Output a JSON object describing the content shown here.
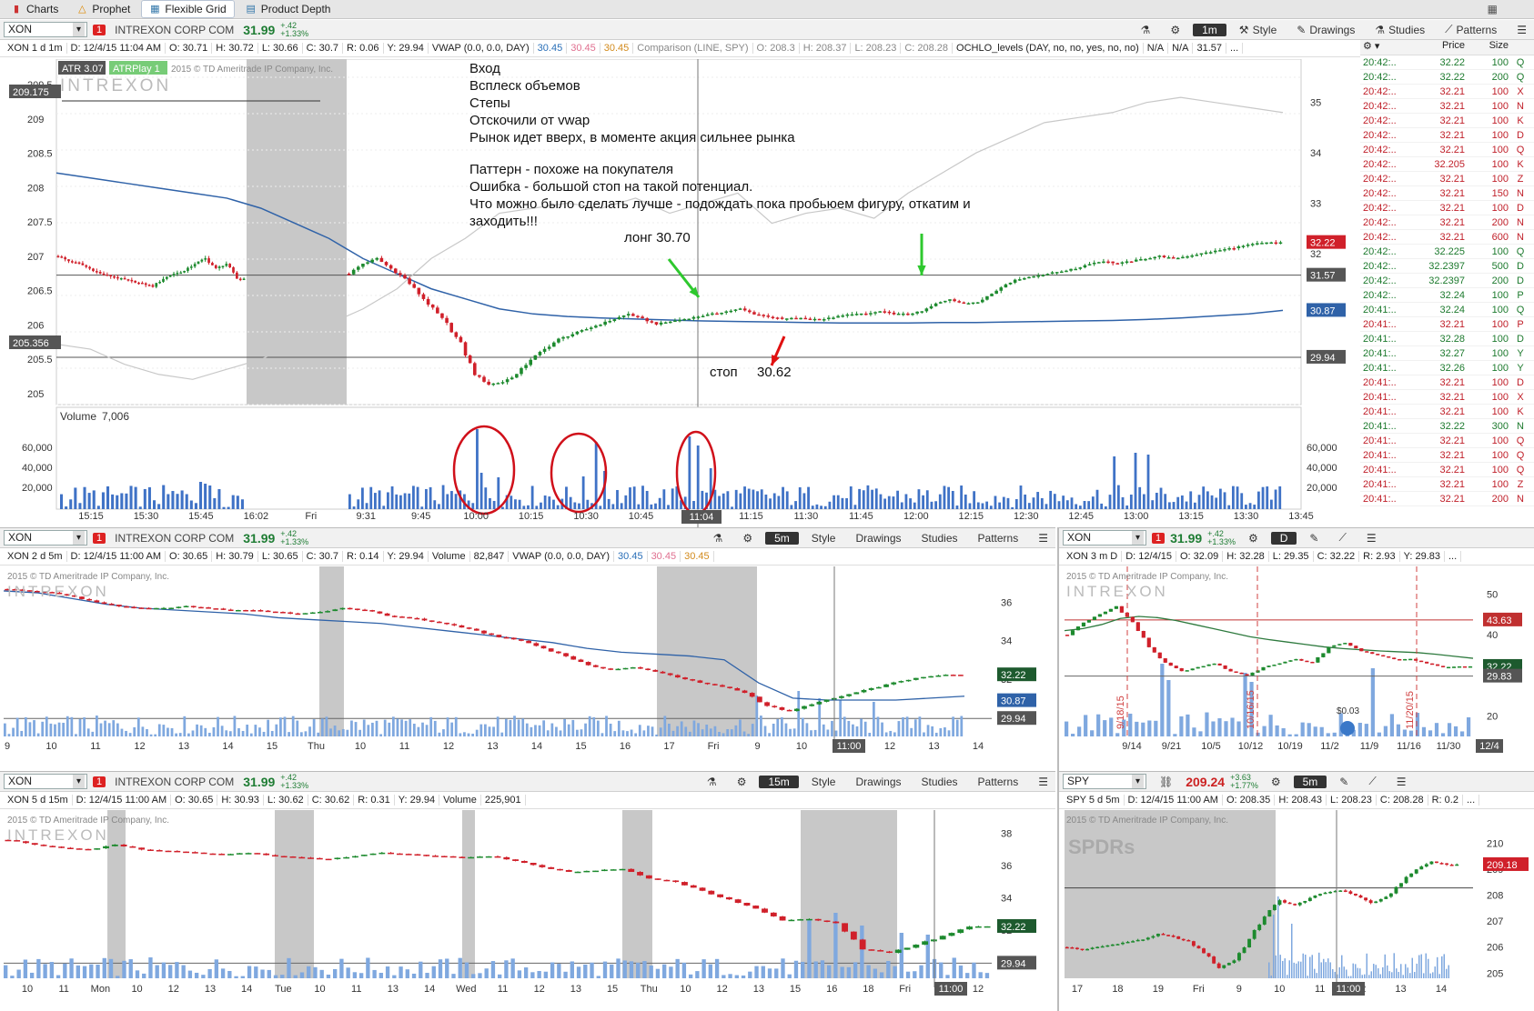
{
  "tabs": [
    {
      "label": "Charts",
      "icon": "bars-icon"
    },
    {
      "label": "Prophet",
      "icon": "triangle-icon"
    },
    {
      "label": "Flexible Grid",
      "icon": "grid-icon"
    },
    {
      "label": "Product Depth",
      "icon": "depth-icon"
    }
  ],
  "common": {
    "symbol": "XON",
    "company": "INTREXON CORP COM",
    "price": "31.99",
    "change": "+.42",
    "change_pct": "+1.33%",
    "style": "Style",
    "drawings": "Drawings",
    "studies": "Studies",
    "patterns": "Patterns",
    "copyright": "2015 © TD Ameritrade IP Company, Inc.",
    "watermark": "INTREXON"
  },
  "main": {
    "aggregation": "1m",
    "info": [
      "XON 1 d 1m",
      "D: 12/4/15 11:04 AM",
      "O: 30.71",
      "H: 30.72",
      "L: 30.66",
      "C: 30.7",
      "R: 0.06",
      "Y: 29.94",
      "VWAP (0.0, 0.0, DAY)",
      "30.45",
      "30.45",
      "30.45",
      "Comparison (LINE, SPY)",
      "O: 208.3",
      "H: 208.37",
      "L: 208.23",
      "C: 208.28",
      "OCHLO_levels (DAY, no, no, yes, no, no)",
      "N/A",
      "N/A",
      "31.57",
      "..."
    ],
    "atr": "ATR 3.07",
    "atrplay": "ATRPlay 1",
    "left_labels": {
      "top": "209.175",
      "bottom": "205.356"
    },
    "right_labels": {
      "last": "32.22",
      "level": "31.57",
      "vwap": "30.87",
      "prevclose": "29.94"
    },
    "annotations": {
      "lines1": [
        "Вход",
        "Всплеск объемов",
        "Степы",
        "Отскочили от vwap",
        "Рынок идет вверх, в моменте акция сильнее рынка"
      ],
      "lines2": [
        "Паттерн - похоже на покупателя",
        "Ошибка - большой стоп на такой потенциал.",
        "Что можно было сделать лучше - подождать пока пробьюем фигуру, откатим и",
        "заходить!!!"
      ],
      "long": "лонг 30.70",
      "stop": "стоп",
      "stop_price": "30.62"
    },
    "volume_label": "Volume",
    "volume_value": "7,006",
    "chart_data": {
      "type": "line",
      "x_ticks": [
        "15:15",
        "15:30",
        "15:45",
        "16:02",
        "Fri",
        "9:31",
        "9:45",
        "10:00",
        "10:15",
        "10:30",
        "10:45",
        "11:04",
        "11:15",
        "11:30",
        "11:45",
        "12:00",
        "12:15",
        "12:30",
        "12:45",
        "13:00",
        "13:15",
        "13:30",
        "13:45"
      ],
      "y_right": [
        "35",
        "34",
        "33",
        "32",
        "30"
      ],
      "y_left": [
        "209.5",
        "209",
        "208.5",
        "208",
        "207.5",
        "207",
        "206.5",
        "206",
        "205.5",
        "205"
      ],
      "vol_ticks": [
        "60,000",
        "40,000",
        "20,000"
      ],
      "ylim": [
        29,
        35.5
      ],
      "series": [
        {
          "name": "",
          "values": [
            31.95,
            31.85,
            31.8,
            31.7,
            31.6,
            31.55,
            31.5,
            31.45,
            31.4,
            31.35,
            31.5,
            31.6,
            31.65,
            31.8,
            31.9,
            31.7,
            31.8,
            31.5,
            31.6,
            31.8,
            31.9,
            31.7,
            31.5,
            31.2,
            30.9,
            30.6,
            30.2,
            29.6,
            29.4,
            29.45,
            29.6,
            29.9,
            30.1,
            30.3,
            30.4,
            30.5,
            30.6,
            30.7,
            30.8,
            30.7,
            30.6,
            30.65,
            30.7,
            30.75,
            30.8,
            30.85,
            30.9,
            30.8,
            30.75,
            30.7,
            30.72,
            30.7,
            30.7,
            30.75,
            30.8,
            30.8,
            30.85,
            30.8,
            30.8,
            30.85,
            31.0,
            31.1,
            31.0,
            31.05,
            31.2,
            31.4,
            31.5,
            31.55,
            31.6,
            31.65,
            31.7,
            31.8,
            31.85,
            31.8,
            31.85,
            31.9,
            31.95,
            31.9,
            31.95,
            32.0,
            32.05,
            32.1,
            32.15,
            32.2,
            32.22
          ]
        },
        {
          "name": "VWAP",
          "values": [
            33.6,
            33.5,
            33.4,
            33.3,
            33.2,
            33.1,
            32.9,
            32.6,
            32.3,
            31.9,
            31.6,
            31.3,
            31.1,
            30.9,
            30.8,
            30.75,
            30.72,
            30.7,
            30.68,
            30.66,
            30.65,
            30.64,
            30.63,
            30.62,
            30.62,
            30.62,
            30.63,
            30.63,
            30.64,
            30.65,
            30.66,
            30.67,
            30.69,
            30.72,
            30.76,
            30.8,
            30.87
          ]
        },
        {
          "name": "SPY",
          "values": [
            30.2,
            30.1,
            29.8,
            29.6,
            29.5,
            29.7,
            29.9,
            30.2,
            30.6,
            30.9,
            31.3,
            31.9,
            32.3,
            32.8,
            32.9,
            33.0,
            32.9,
            33.1,
            32.8,
            33.0,
            33.2,
            32.6,
            32.8,
            32.9,
            32.7,
            33.2,
            33.6,
            34.0,
            34.3,
            34.6,
            34.7,
            34.8,
            35.0,
            35.1,
            35.0,
            34.9,
            34.8
          ]
        }
      ]
    }
  },
  "tsg": {
    "headers": [
      "",
      "Price",
      "Size",
      ""
    ],
    "rows": [
      [
        "20:42:..",
        "32.22",
        "100",
        "Q"
      ],
      [
        "20:42:..",
        "32.22",
        "200",
        "Q"
      ],
      [
        "20:42:..",
        "32.21",
        "100",
        "X"
      ],
      [
        "20:42:..",
        "32.21",
        "100",
        "N"
      ],
      [
        "20:42:..",
        "32.21",
        "100",
        "K"
      ],
      [
        "20:42:..",
        "32.21",
        "100",
        "D"
      ],
      [
        "20:42:..",
        "32.21",
        "100",
        "Q"
      ],
      [
        "20:42:..",
        "32.205",
        "100",
        "K"
      ],
      [
        "20:42:..",
        "32.21",
        "100",
        "Z"
      ],
      [
        "20:42:..",
        "32.21",
        "150",
        "N"
      ],
      [
        "20:42:..",
        "32.21",
        "100",
        "D"
      ],
      [
        "20:42:..",
        "32.21",
        "200",
        "N"
      ],
      [
        "20:42:..",
        "32.21",
        "600",
        "N"
      ],
      [
        "20:42:..",
        "32.225",
        "100",
        "Q"
      ],
      [
        "20:42:..",
        "32.2397",
        "500",
        "D"
      ],
      [
        "20:42:..",
        "32.2397",
        "200",
        "D"
      ],
      [
        "20:42:..",
        "32.24",
        "100",
        "P"
      ],
      [
        "20:41:..",
        "32.24",
        "100",
        "Q"
      ],
      [
        "20:41:..",
        "32.21",
        "100",
        "P"
      ],
      [
        "20:41:..",
        "32.28",
        "100",
        "D"
      ],
      [
        "20:41:..",
        "32.27",
        "100",
        "Y"
      ],
      [
        "20:41:..",
        "32.26",
        "100",
        "Y"
      ],
      [
        "20:41:..",
        "32.21",
        "100",
        "D"
      ],
      [
        "20:41:..",
        "32.21",
        "100",
        "X"
      ],
      [
        "20:41:..",
        "32.21",
        "100",
        "K"
      ],
      [
        "20:41:..",
        "32.22",
        "300",
        "N"
      ],
      [
        "20:41:..",
        "32.21",
        "100",
        "Q"
      ],
      [
        "20:41:..",
        "32.21",
        "100",
        "Q"
      ],
      [
        "20:41:..",
        "32.21",
        "100",
        "Q"
      ],
      [
        "20:41:..",
        "32.21",
        "100",
        "Z"
      ],
      [
        "20:41:..",
        "32.21",
        "200",
        "N"
      ]
    ]
  },
  "p2": {
    "aggregation": "5m",
    "info": [
      "XON 2 d 5m",
      "D: 12/4/15 11:00 AM",
      "O: 30.65",
      "H: 30.79",
      "L: 30.65",
      "C: 30.7",
      "R: 0.14",
      "Y: 29.94",
      "Volume",
      "82,847",
      "VWAP (0.0, 0.0, DAY)",
      "30.45",
      "30.45",
      "30.45"
    ],
    "labels": {
      "last": "32.22",
      "vwap": "30.87",
      "prev": "29.94",
      "cursor": "11:00"
    },
    "chart_data": {
      "type": "line",
      "x_ticks": [
        "9",
        "10",
        "11",
        "12",
        "13",
        "14",
        "15",
        "Thu",
        "10",
        "11",
        "12",
        "13",
        "14",
        "15",
        "16",
        "17",
        "Fri",
        "9",
        "10",
        "11",
        "12",
        "13",
        "14"
      ],
      "y_right": [
        "36",
        "34",
        "32"
      ],
      "ylim": [
        29,
        37.5
      ],
      "series": [
        {
          "name": "",
          "values": [
            36.7,
            36.6,
            36.5,
            36.3,
            36.0,
            35.8,
            35.7,
            35.7,
            35.8,
            35.7,
            35.6,
            35.6,
            35.5,
            35.4,
            35.5,
            35.7,
            35.6,
            35.3,
            35.2,
            35.0,
            34.8,
            34.5,
            34.2,
            34.0,
            33.6,
            33.2,
            32.7,
            32.5,
            32.6,
            32.4,
            32.1,
            31.8,
            31.6,
            31.3,
            30.6,
            30.3,
            30.7,
            31.0,
            31.3,
            31.6,
            31.9,
            32.1,
            32.22
          ]
        }
      ]
    }
  },
  "p3": {
    "aggregation": "D",
    "info": [
      "XON 3 m D",
      "D: 12/4/15",
      "O: 32.09",
      "H: 32.28",
      "L: 29.35",
      "C: 32.22",
      "R: 2.93",
      "Y: 29.83",
      "..."
    ],
    "labels": {
      "a": "43.63",
      "b": "32.22",
      "c": "29.83",
      "tag": "$0.03",
      "cursor": "12/4"
    },
    "dates": [
      "9/18/15",
      "10/16/15",
      "11/20/15"
    ],
    "chart_data": {
      "type": "line",
      "x_ticks": [
        "9/14",
        "9/21",
        "10/5",
        "10/12",
        "10/19",
        "11/2",
        "11/9",
        "11/16",
        "11/30"
      ],
      "y_right": [
        "50",
        "40",
        "30",
        "20"
      ],
      "ylim": [
        15,
        55
      ],
      "series": [
        {
          "name": "",
          "values": [
            40,
            43,
            45,
            47,
            43,
            37,
            33,
            31,
            32,
            33,
            31,
            30,
            32,
            33,
            34,
            33,
            37,
            38,
            36,
            35,
            34,
            34,
            33,
            32,
            32.22
          ]
        }
      ]
    }
  },
  "p4": {
    "aggregation": "15m",
    "info": [
      "XON 5 d 15m",
      "D: 12/4/15 11:00 AM",
      "O: 30.65",
      "H: 30.93",
      "L: 30.62",
      "C: 30.62",
      "R: 0.31",
      "Y: 29.94",
      "Volume",
      "225,901"
    ],
    "labels": {
      "last": "32.22",
      "prev": "29.94",
      "cursor": "11:00"
    },
    "chart_data": {
      "type": "line",
      "x_ticks": [
        "10",
        "11",
        "Mon",
        "10",
        "12",
        "13",
        "14",
        "Tue",
        "10",
        "11",
        "13",
        "14",
        "Wed",
        "11",
        "12",
        "13",
        "15",
        "Thu",
        "10",
        "12",
        "13",
        "15",
        "16",
        "18",
        "Fri",
        "10",
        "12"
      ],
      "y_right": [
        "38",
        "36",
        "34",
        "32"
      ],
      "ylim": [
        29,
        39
      ],
      "series": [
        {
          "name": "",
          "values": [
            37.6,
            37.3,
            37.1,
            37.0,
            37.3,
            37.0,
            36.9,
            36.8,
            36.7,
            36.8,
            36.6,
            36.5,
            36.4,
            36.6,
            36.8,
            36.7,
            36.6,
            36.5,
            36.6,
            36.3,
            35.9,
            35.6,
            35.7,
            35.8,
            35.2,
            35.0,
            34.4,
            33.9,
            33.3,
            32.6,
            32.7,
            32.4,
            30.8,
            30.6,
            31.1,
            31.6,
            32.22
          ]
        }
      ]
    }
  },
  "p5": {
    "symbol": "SPY",
    "price": "209.24",
    "change": "+3.63",
    "change_pct": "+1.77%",
    "aggregation": "5m",
    "info": [
      "SPY 5 d 5m",
      "D: 12/4/15 11:00 AM",
      "O: 208.35",
      "H: 208.43",
      "L: 208.23",
      "C: 208.28",
      "R: 0.2",
      "..."
    ],
    "labels": {
      "last": "209.18",
      "cursor": "11:00"
    },
    "watermark": "SPDRs",
    "chart_data": {
      "type": "line",
      "x_ticks": [
        "17",
        "18",
        "19",
        "Fri",
        "9",
        "10",
        "11",
        "12",
        "13",
        "14"
      ],
      "y_right": [
        "210",
        "209",
        "208",
        "207",
        "206",
        "205"
      ],
      "ylim": [
        204.8,
        211
      ],
      "series": [
        {
          "name": "",
          "values": [
            206.0,
            205.9,
            206.0,
            206.1,
            206.2,
            206.3,
            206.5,
            206.4,
            206.2,
            205.8,
            205.2,
            205.5,
            206.3,
            207.2,
            207.8,
            207.6,
            207.9,
            208.1,
            208.2,
            208.0,
            207.7,
            207.9,
            208.5,
            209.0,
            209.3,
            209.18
          ]
        }
      ]
    }
  }
}
